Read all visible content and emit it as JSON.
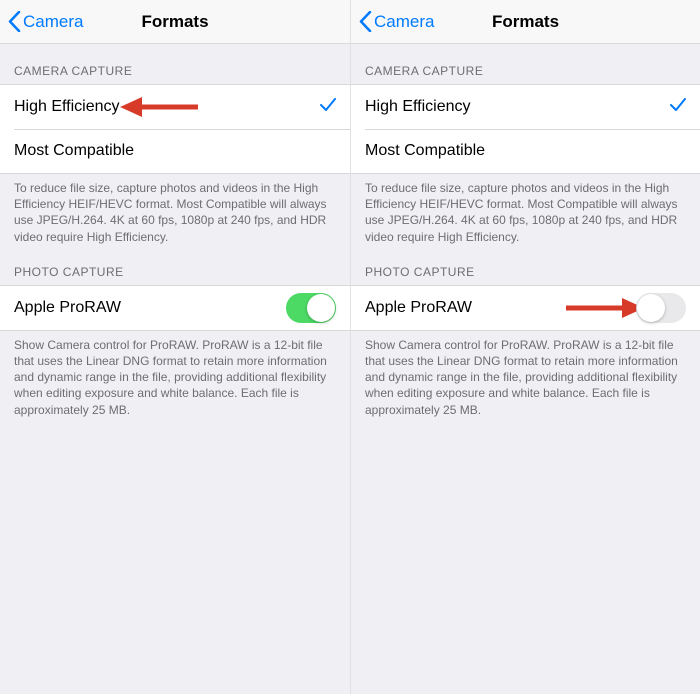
{
  "nav": {
    "back_label": "Camera",
    "title": "Formats"
  },
  "sections": {
    "camera_capture": {
      "header": "CAMERA CAPTURE",
      "items": [
        {
          "label": "High Efficiency",
          "checked": true
        },
        {
          "label": "Most Compatible",
          "checked": false
        }
      ],
      "footer": "To reduce file size, capture photos and videos in the High Efficiency HEIF/HEVC format. Most Compatible will always use JPEG/H.264. 4K at 60 fps, 1080p at 240 fps, and HDR video require High Efficiency."
    },
    "photo_capture": {
      "header": "PHOTO CAPTURE",
      "item_label": "Apple ProRAW",
      "footer": "Show Camera control for ProRAW. ProRAW is a 12-bit file that uses the Linear DNG format to retain more information and dynamic range in the file, providing additional flexibility when editing exposure and white balance. Each file is approximately 25 MB."
    }
  },
  "panels": [
    {
      "proraw_on": true,
      "annotation_arrow": {
        "target": "high-efficiency"
      }
    },
    {
      "proraw_on": false,
      "annotation_arrow": {
        "target": "proraw-toggle"
      }
    }
  ]
}
